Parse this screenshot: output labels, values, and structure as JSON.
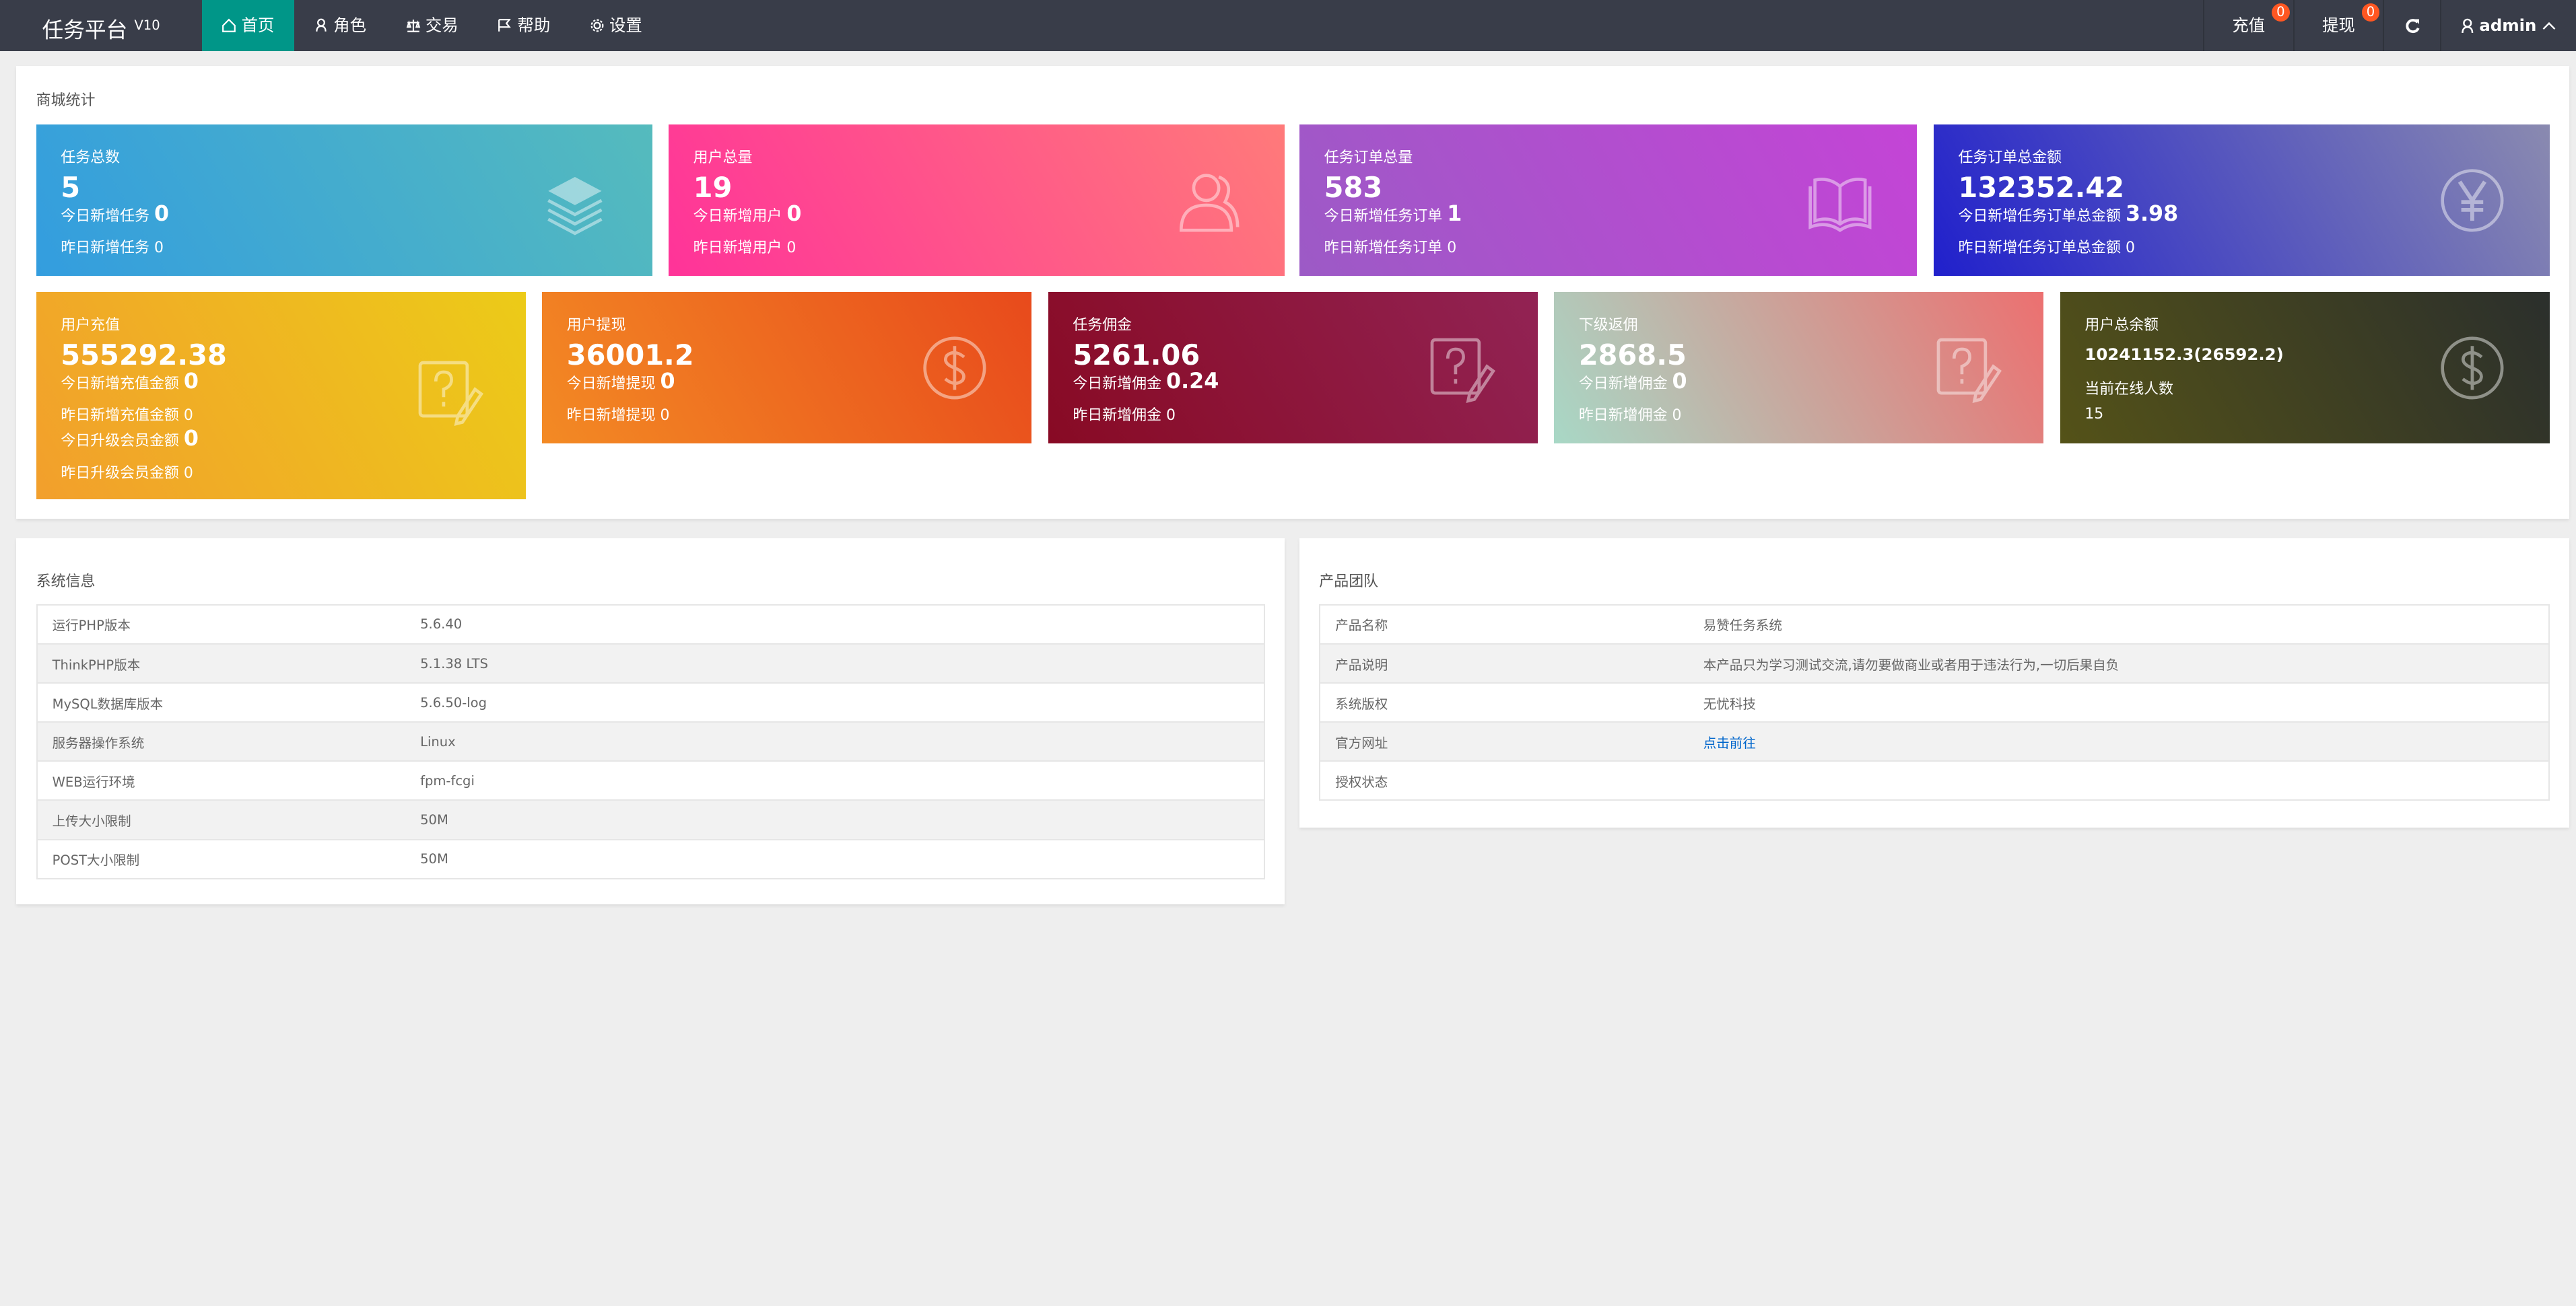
{
  "header": {
    "logo": "任务平台",
    "version": "V10",
    "nav": [
      {
        "label": "首页",
        "icon": "home-icon",
        "active": true
      },
      {
        "label": "角色",
        "icon": "user-icon"
      },
      {
        "label": "交易",
        "icon": "scale-icon"
      },
      {
        "label": "帮助",
        "icon": "flag-icon"
      },
      {
        "label": "设置",
        "icon": "gear-icon"
      }
    ],
    "recharge": {
      "label": "充值",
      "badge": "0"
    },
    "withdraw": {
      "label": "提现",
      "badge": "0"
    },
    "user": "admin"
  },
  "stats": {
    "title": "商城统计",
    "cards": [
      {
        "title": "任务总数",
        "value": "5",
        "lines": [
          {
            "label": "今日新增任务",
            "value": "0",
            "bold": true
          },
          {
            "label": "昨日新增任务",
            "value": "0"
          }
        ],
        "icon": "layers-icon",
        "gradient": [
          "#339ddf",
          "#55bbbd"
        ]
      },
      {
        "title": "用户总量",
        "value": "19",
        "lines": [
          {
            "label": "今日新增用户",
            "value": "0",
            "bold": true
          },
          {
            "label": "昨日新增用户",
            "value": "0"
          }
        ],
        "icon": "users-icon",
        "gradient": [
          "#ff3399",
          "#ff7a7a"
        ]
      },
      {
        "title": "任务订单总量",
        "value": "583",
        "lines": [
          {
            "label": "今日新增任务订单",
            "value": "1",
            "bold": true
          },
          {
            "label": "昨日新增任务订单",
            "value": "0"
          }
        ],
        "icon": "book-icon",
        "gradient": [
          "#9c5ac6",
          "#c444d6"
        ]
      },
      {
        "title": "任务订单总金额",
        "value": "132352.42",
        "lines": [
          {
            "label": "今日新增任务订单总金额",
            "value": "3.98",
            "bold": true
          },
          {
            "label": "昨日新增任务订单总金额",
            "value": "0"
          }
        ],
        "icon": "yen-icon",
        "gradient": [
          "#2020cc",
          "#8a8ab0"
        ]
      },
      {
        "title": "用户充值",
        "value": "555292.38",
        "lines": [
          {
            "label": "今日新增充值金额",
            "value": "0",
            "bold": true
          },
          {
            "label": "昨日新增充值金额",
            "value": "0"
          },
          {
            "label": "今日升级会员金额",
            "value": "0",
            "bold": true
          },
          {
            "label": "昨日升级会员金额",
            "value": "0"
          }
        ],
        "icon": "question-edit-icon",
        "gradient": [
          "#f29f2c",
          "#eccb18"
        ]
      },
      {
        "title": "用户提现",
        "value": "36001.2",
        "lines": [
          {
            "label": "今日新增提现",
            "value": "0",
            "bold": true
          },
          {
            "label": "昨日新增提现",
            "value": "0"
          }
        ],
        "icon": "dollar-icon",
        "gradient": [
          "#f38a24",
          "#e84a1c"
        ]
      },
      {
        "title": "任务佣金",
        "value": "5261.06",
        "lines": [
          {
            "label": "今日新增佣金",
            "value": "0.24",
            "bold": true
          },
          {
            "label": "昨日新增佣金",
            "value": "0"
          }
        ],
        "icon": "question-edit-icon",
        "gradient": [
          "#880a24",
          "#922354"
        ]
      },
      {
        "title": "下级返佣",
        "value": "2868.5",
        "lines": [
          {
            "label": "今日新增佣金",
            "value": "0",
            "bold": true
          },
          {
            "label": "昨日新增佣金",
            "value": "0"
          }
        ],
        "icon": "question-edit-icon",
        "gradient": [
          "#a8d8c6",
          "#ec7070"
        ]
      },
      {
        "title": "用户总余额",
        "value": "10241152.3(26592.2)",
        "lines": [
          {
            "label": "当前在线人数",
            "value": ""
          },
          {
            "label": "15",
            "value": ""
          }
        ],
        "icon": "dollar-icon",
        "gradient": [
          "#545218",
          "#2b2f2c"
        ]
      }
    ]
  },
  "system": {
    "title": "系统信息",
    "rows": [
      [
        "运行PHP版本",
        "5.6.40"
      ],
      [
        "ThinkPHP版本",
        "5.1.38 LTS"
      ],
      [
        "MySQL数据库版本",
        "5.6.50-log"
      ],
      [
        "服务器操作系统",
        "Linux"
      ],
      [
        "WEB运行环境",
        "fpm-fcgi"
      ],
      [
        "上传大小限制",
        "50M"
      ],
      [
        "POST大小限制",
        "50M"
      ]
    ]
  },
  "team": {
    "title": "产品团队",
    "rows": [
      [
        "产品名称",
        "易赞任务系统"
      ],
      [
        "产品说明",
        "本产品只为学习测试交流,请勿要做商业或者用于违法行为,一切后果自负"
      ],
      [
        "系统版权",
        "无忧科技"
      ],
      [
        "官方网址",
        "点击前往"
      ],
      [
        "授权状态",
        ""
      ]
    ]
  }
}
